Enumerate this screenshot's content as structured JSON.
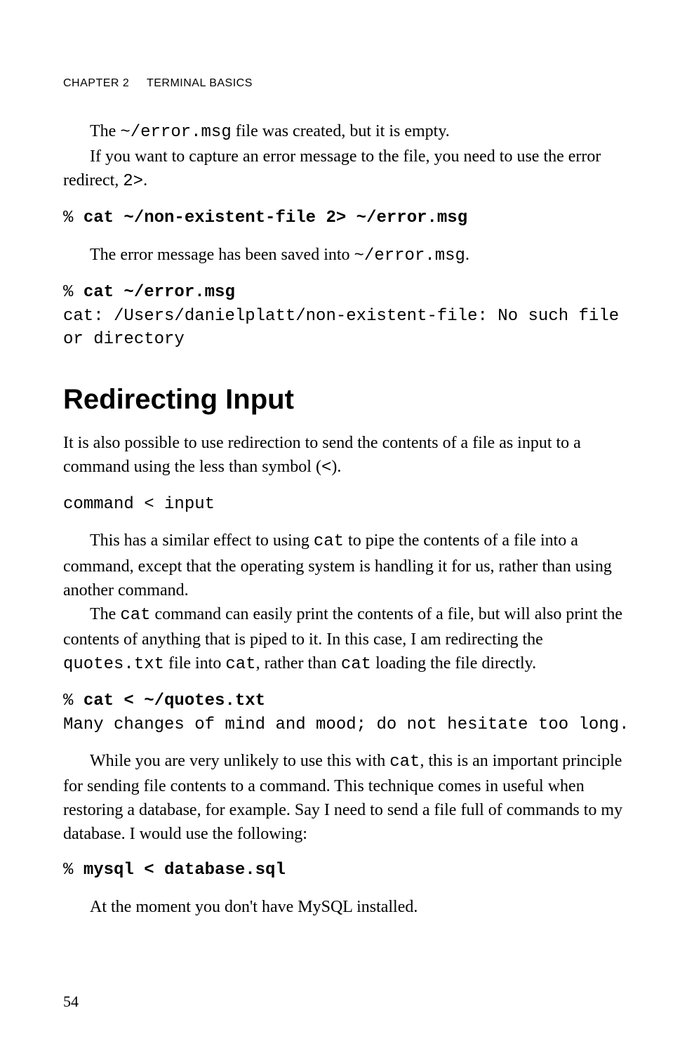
{
  "header": {
    "chapter": "Chapter 2",
    "title": "Terminal Basics"
  },
  "para1_a": "The ",
  "para1_code": "~/error.msg",
  "para1_b": " file was created, but it is empty.",
  "para2_a": "If you want to capture an error message to the file, you need to use the error redirect, ",
  "para2_code": "2>",
  "para2_b": ".",
  "code1_prompt": "% ",
  "code1_cmd": "cat ~/non-existent-file 2> ~/error.msg",
  "para3_a": "The error message has been saved into ",
  "para3_code": "~/error.msg",
  "para3_b": ".",
  "code2_prompt": "% ",
  "code2_cmd": "cat ~/error.msg",
  "code2_out": "cat: /Users/danielplatt/non-existent-file: No such file or directory",
  "section_heading": "Redirecting Input",
  "para4_a": "It is also possible to use redirection to send the contents of a file as input to a command using the less than symbol (",
  "para4_code": "<",
  "para4_b": ").",
  "code3": "command < input",
  "para5_a": "This has a similar effect to using ",
  "para5_code": "cat",
  "para5_b": " to pipe the contents of a file into a command, except that the operating system is handling it for us, rather than using another command.",
  "para6_a": "The ",
  "para6_code1": "cat",
  "para6_b": " command can easily print the contents of a file, but will also print the contents of anything that is piped to it. In this case, I am redirecting the ",
  "para6_code2": "quotes.txt",
  "para6_c": " file into ",
  "para6_code3": "cat",
  "para6_d": ", rather than ",
  "para6_code4": "cat",
  "para6_e": " loading the file directly.",
  "code4_prompt": "% ",
  "code4_cmd": "cat < ~/quotes.txt",
  "code4_out": "Many changes of mind and mood; do not hesitate too long.",
  "para7_a": "While you are very unlikely to use this with ",
  "para7_code": "cat",
  "para7_b": ", this is an important principle for sending file contents to a command. This technique comes in useful when restoring a database, for example. Say I need to send a file full of commands to my database. I would use the following:",
  "code5_prompt": "% ",
  "code5_cmd": "mysql < database.sql",
  "para8": "At the moment you don't have MySQL installed.",
  "page_number": "54"
}
